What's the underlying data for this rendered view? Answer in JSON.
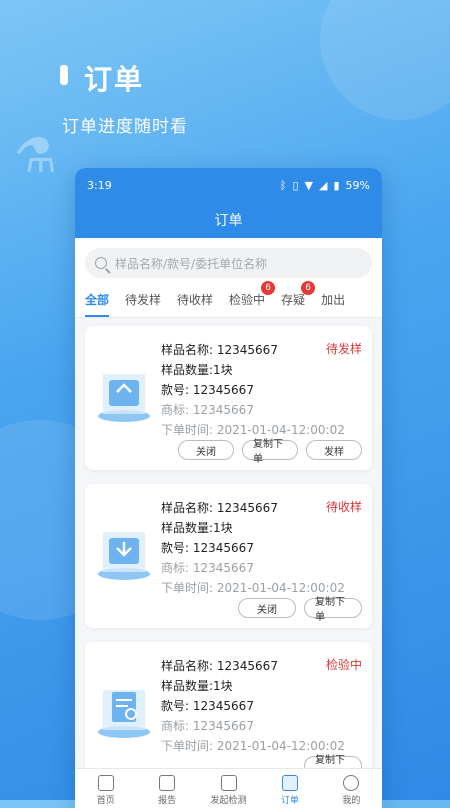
{
  "hero": {
    "title": "订单",
    "subtitle": "订单进度随时看"
  },
  "status_bar": {
    "time": "3:19",
    "battery": "59%"
  },
  "navbar": {
    "title": "订单"
  },
  "search": {
    "placeholder": "样品名称/款号/委托单位名称"
  },
  "tabs": [
    {
      "label": "全部",
      "active": true
    },
    {
      "label": "待发样"
    },
    {
      "label": "待收样"
    },
    {
      "label": "检验中",
      "badge": "6"
    },
    {
      "label": "存疑",
      "badge": "6"
    },
    {
      "label": "加出"
    }
  ],
  "orders": [
    {
      "name_label": "样品名称:",
      "name": "12345667",
      "qty_label": "样品数量:",
      "qty": "1块",
      "style_label": "款号:",
      "style": "12345667",
      "brand_label": "商标:",
      "brand": "12345667",
      "time_label": "下单时间:",
      "time": "2021-01-04-12:00:02",
      "status": "待发样",
      "actions": [
        "关闭",
        "复制下单",
        "发样"
      ]
    },
    {
      "name_label": "样品名称:",
      "name": "12345667",
      "qty_label": "样品数量:",
      "qty": "1块",
      "style_label": "款号:",
      "style": "12345667",
      "brand_label": "商标:",
      "brand": "12345667",
      "time_label": "下单时间:",
      "time": "2021-01-04-12:00:02",
      "status": "待收样",
      "actions": [
        "关闭",
        "复制下单"
      ]
    },
    {
      "name_label": "样品名称:",
      "name": "12345667",
      "qty_label": "样品数量:",
      "qty": "1块",
      "style_label": "款号:",
      "style": "12345667",
      "brand_label": "商标:",
      "brand": "12345667",
      "time_label": "下单时间:",
      "time": "2021-01-04-12:00:02",
      "status": "检验中",
      "actions": [
        "复制下单"
      ]
    }
  ],
  "tabbar": [
    {
      "label": "首页",
      "icon": "home-icon"
    },
    {
      "label": "报告",
      "icon": "report-icon"
    },
    {
      "label": "发起检测",
      "icon": "scan-icon"
    },
    {
      "label": "订单",
      "icon": "order-icon",
      "active": true
    },
    {
      "label": "我的",
      "icon": "user-icon"
    }
  ]
}
